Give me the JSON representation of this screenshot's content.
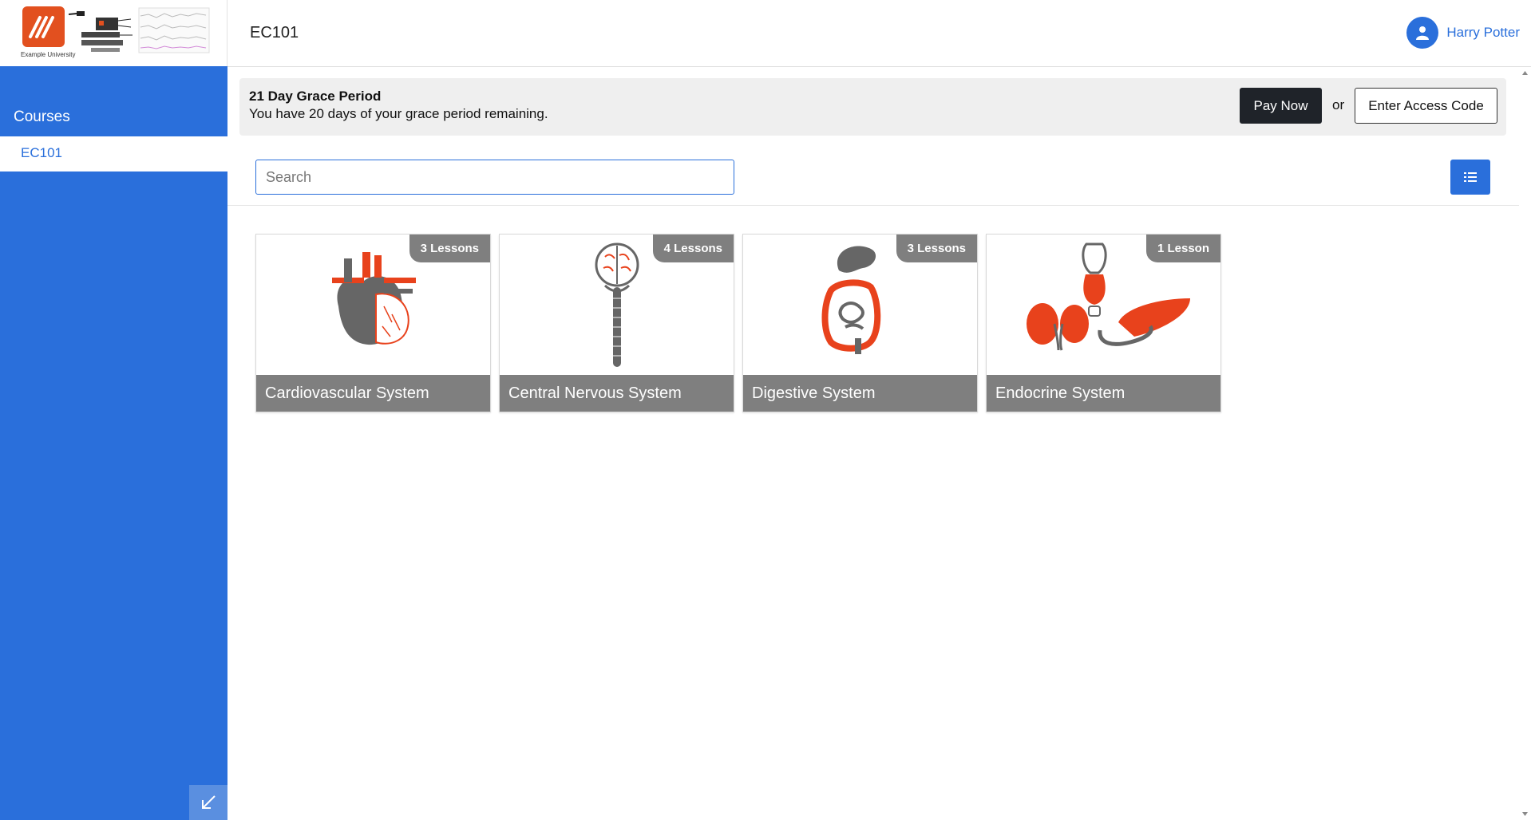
{
  "logo": {
    "org_name": "Example University"
  },
  "sidebar": {
    "heading": "Courses",
    "items": [
      {
        "label": "EC101"
      }
    ]
  },
  "header": {
    "title": "EC101",
    "user_name": "Harry Potter"
  },
  "banner": {
    "title": "21 Day Grace Period",
    "text": "You have 20 days of your grace period remaining.",
    "pay_label": "Pay Now",
    "or_label": "or",
    "access_label": "Enter Access Code"
  },
  "search": {
    "placeholder": "Search",
    "value": ""
  },
  "courses": [
    {
      "title": "Cardiovascular System",
      "lessons": "3 Lessons",
      "icon": "heart-icon"
    },
    {
      "title": "Central Nervous System",
      "lessons": "4 Lessons",
      "icon": "brain-spine-icon"
    },
    {
      "title": "Digestive System",
      "lessons": "3 Lessons",
      "icon": "digestive-icon"
    },
    {
      "title": "Endocrine System",
      "lessons": "1 Lesson",
      "icon": "endocrine-icon"
    }
  ],
  "colors": {
    "accent": "#2a6fdb",
    "organ": "#e8421c",
    "organ_gray": "#666666",
    "card_footer": "#7f7f7f"
  }
}
